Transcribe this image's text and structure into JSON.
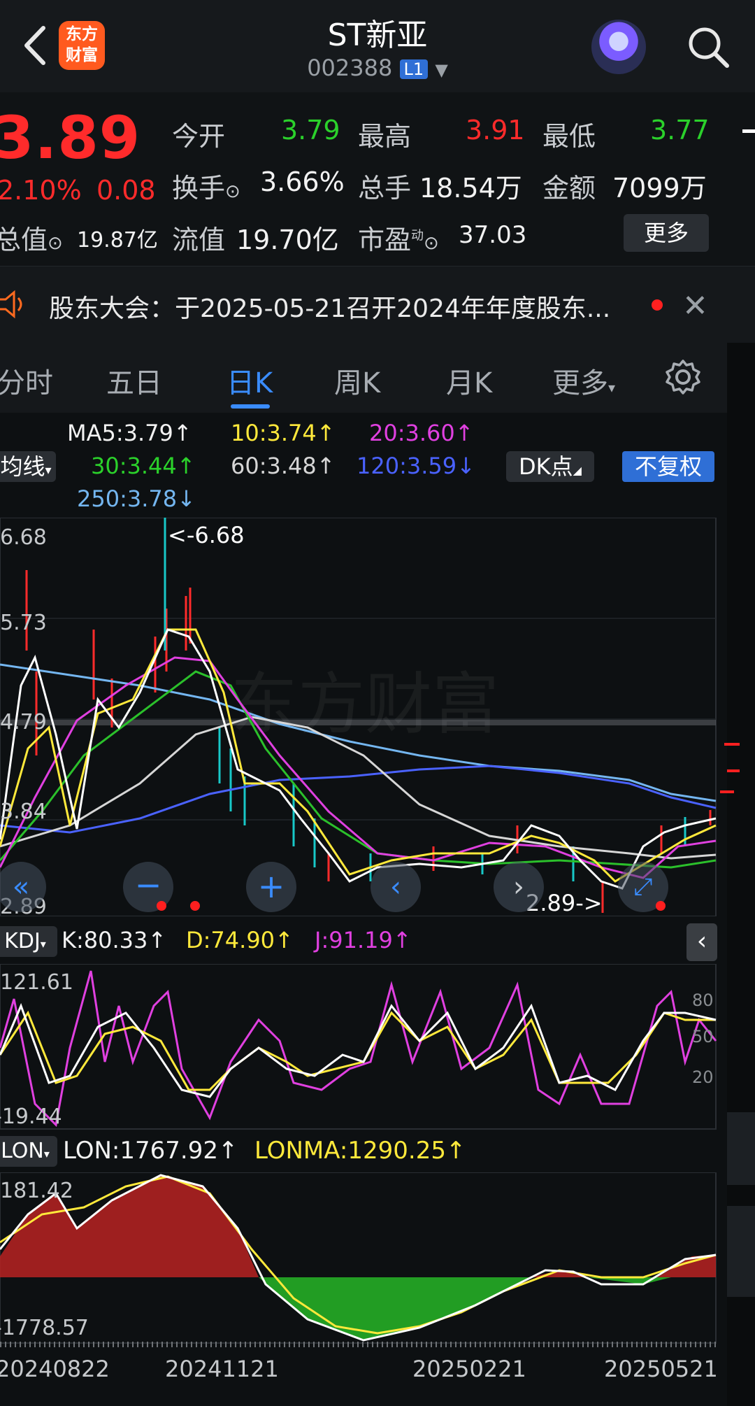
{
  "header": {
    "logo_text": "东方财富",
    "title": "ST新亚",
    "code": "002388",
    "level": "L1"
  },
  "quote": {
    "price": "3.89",
    "change_pct": "2.10%",
    "change": "0.08",
    "open_label": "今开",
    "open": "3.79",
    "high_label": "最高",
    "high": "3.91",
    "low_label": "最低",
    "low": "3.77",
    "turnover_label": "换手",
    "turnover": "3.66%",
    "volume_label": "总手",
    "volume": "18.54万",
    "amount_label": "金额",
    "amount": "7099万",
    "total_cap_label": "总值",
    "total_cap": "19.87亿",
    "float_cap_label": "流值",
    "float_cap": "19.70亿",
    "pe_label": "市盈",
    "pe_sup": "动",
    "pe": "37.03",
    "more_label": "更多"
  },
  "notice": {
    "text": "股东大会：于2025-05-21召开2024年年度股东..."
  },
  "tabs": [
    "分时",
    "五日",
    "日K",
    "周K",
    "月K",
    "更多"
  ],
  "ma": {
    "ma5": "MA5:3.79",
    "ma10": "10:3.74",
    "ma20": "20:3.60",
    "ma30": "30:3.44",
    "ma60": "60:3.48",
    "ma120": "120:3.59",
    "ma250": "250:3.78",
    "type_label": "均线",
    "dk_label": "DK点",
    "fq_label": "不复权"
  },
  "kline": {
    "axis_labels": [
      "6.68",
      "5.73",
      "4.79",
      "3.84",
      "2.89"
    ],
    "max_annot": "<-6.68",
    "min_annot": "2.89->"
  },
  "kdj": {
    "label": "KDJ",
    "k": "K:80.33",
    "d": "D:74.90",
    "j": "J:91.19",
    "top": "121.61",
    "bottom": "-19.44",
    "levels": [
      "80",
      "50",
      "20"
    ]
  },
  "lon": {
    "label": "LON",
    "lon": "LON:1767.92",
    "lonma": "LONMA:1290.25",
    "top": "181.42",
    "bottom": "-1778.57"
  },
  "dates": [
    "20240822",
    "20241121",
    "20250221",
    "20250521"
  ],
  "colors": {
    "up": "#ff2b2b",
    "down": "#2bd12b",
    "accent": "#2f6fd6",
    "ma5": "#ffffff",
    "ma10": "#ffe93b",
    "ma20": "#e040e0",
    "ma30": "#2bc02b",
    "ma60": "#cfcfcf",
    "ma120": "#4a62ff",
    "ma250": "#74b6f0"
  }
}
